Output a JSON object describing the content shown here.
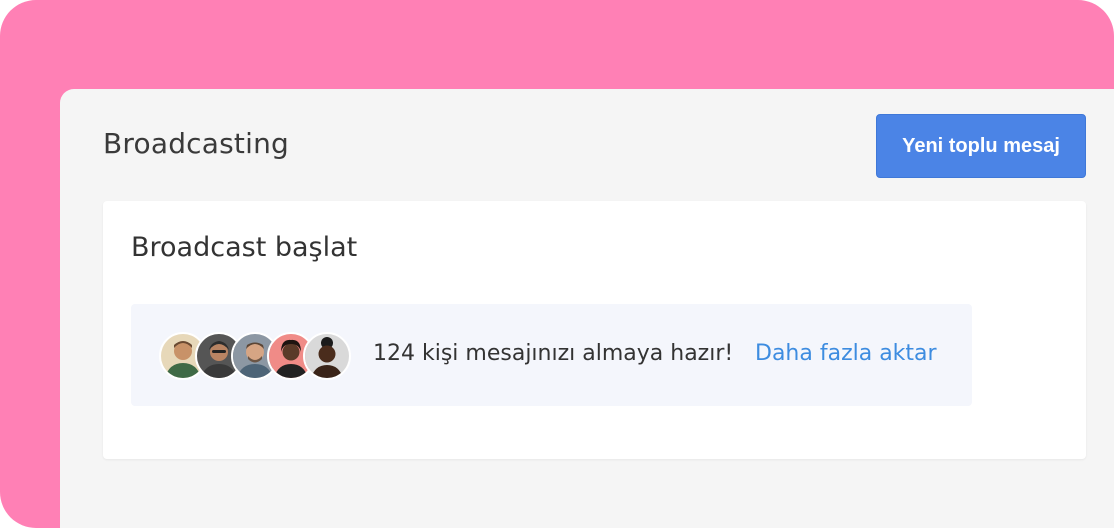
{
  "header": {
    "title": "Broadcasting",
    "new_broadcast_label": "Yeni toplu mesaj"
  },
  "card": {
    "title": "Broadcast başlat",
    "ready_message": "124 kişi mesajınızı almaya hazır!",
    "import_more_label": "Daha fazla aktar"
  },
  "avatars": [
    {
      "name": "avatar-1"
    },
    {
      "name": "avatar-2"
    },
    {
      "name": "avatar-3"
    },
    {
      "name": "avatar-4"
    },
    {
      "name": "avatar-5"
    }
  ],
  "colors": {
    "background": "#ff80b5",
    "panel": "#f5f5f5",
    "primary": "#4b84e6",
    "link": "#3d8ce0",
    "banner": "#f4f6fc"
  }
}
